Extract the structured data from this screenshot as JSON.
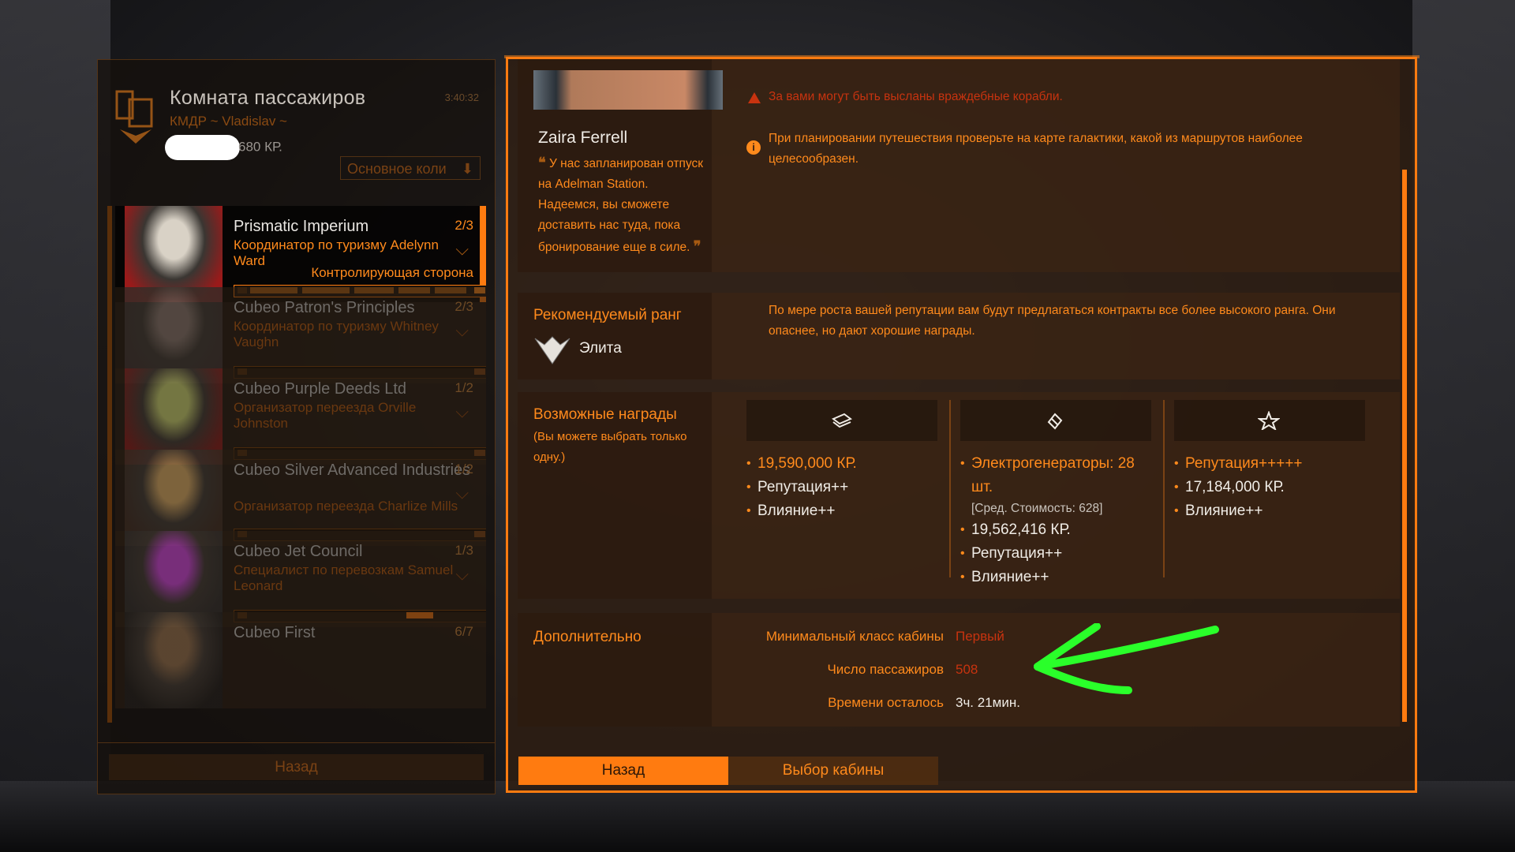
{
  "left_panel": {
    "title": "Комната пассажиров",
    "subtitle": "КМДР ~ Vladislav ~",
    "credits": "680 КР.",
    "time": "3:40:32",
    "sort_label": "Основное коли",
    "back_label": "Назад",
    "missions": [
      {
        "name": "Prismatic Imperium",
        "count": "2/3",
        "giver": "Координатор по туризму Adelynn Ward",
        "faction": "Контролирующая сторона"
      },
      {
        "name": "Cubeo Patron's Principles",
        "count": "2/3",
        "giver": "Координатор по туризму Whitney Vaughn",
        "faction": ""
      },
      {
        "name": "Cubeo Purple Deeds Ltd",
        "count": "1/2",
        "giver": "Организатор переезда Orville Johnston",
        "faction": ""
      },
      {
        "name": "Cubeo Silver Advanced Industries",
        "count": "1/2",
        "giver": "Организатор переезда Charlize Mills",
        "faction": ""
      },
      {
        "name": "Cubeo Jet Council",
        "count": "1/3",
        "giver": "Специалист по перевозкам Samuel Leonard",
        "faction": ""
      },
      {
        "name": "Cubeo First",
        "count": "6/7",
        "giver": "",
        "faction": ""
      }
    ]
  },
  "detail": {
    "passenger_name": "Zaira Ferrell",
    "quote": "У нас запланирован отпуск на Adelman Station. Надеемся, вы сможете доставить нас туда, пока бронирование еще в силе.",
    "warning_text": "За вами могут быть высланы враждебные корабли.",
    "info_text": "При планировании путешествия проверьте на карте галактики, какой из маршрутов наиболее целесообразен.",
    "rank_title": "Рекомендуемый ранг",
    "rank_value": "Элита",
    "rank_note": "По мере роста вашей репутации вам будут предлагаться контракты все более высокого ранга. Они опаснее, но дают хорошие награды.",
    "rewards_title": "Возможные награды",
    "rewards_note": "(Вы можете выбрать только одну.)",
    "reward_options": [
      {
        "icon": "credits-icon",
        "items": [
          {
            "text": "19,590,000 КР.",
            "highlight": true
          },
          {
            "text": "Репутация++",
            "highlight": false
          },
          {
            "text": "Влияние++",
            "highlight": false
          }
        ]
      },
      {
        "icon": "commodity-icon",
        "items": [
          {
            "text": "Электрогенераторы: 28 шт.",
            "highlight": true
          },
          {
            "text": "[Сред. Стоимость: 628]",
            "sub": true
          },
          {
            "text": "19,562,416 КР.",
            "highlight": false
          },
          {
            "text": "Репутация++",
            "highlight": false
          },
          {
            "text": "Влияние++",
            "highlight": false
          }
        ]
      },
      {
        "icon": "reputation-star-icon",
        "items": [
          {
            "text": "Репутация+++++",
            "highlight": true
          },
          {
            "text": "17,184,000 КР.",
            "highlight": false
          },
          {
            "text": "Влияние++",
            "highlight": false
          }
        ]
      }
    ],
    "additional_title": "Дополнительно",
    "additional": [
      {
        "label": "Минимальный класс кабины",
        "value": "Первый",
        "color": "red"
      },
      {
        "label": "Число пассажиров",
        "value": "508",
        "color": "red"
      },
      {
        "label": "Времени осталось",
        "value": "3ч. 21мин.",
        "color": "white"
      }
    ],
    "back_button": "Назад",
    "cabin_button": "Выбор кабины"
  },
  "colors": {
    "accent": "#ff7b10",
    "text_orange": "#ff8a1c",
    "warning": "#c8330f",
    "annotation_arrow": "#2aff2a"
  }
}
